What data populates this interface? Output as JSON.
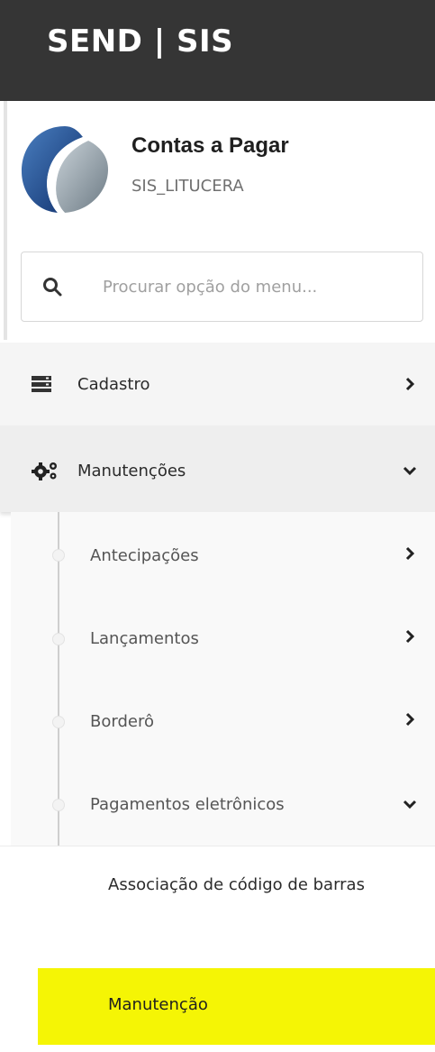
{
  "header": {
    "brand": "SEND | SIS"
  },
  "profile": {
    "title": "Contas a Pagar",
    "subtitle": "SIS_LITUCERA"
  },
  "search": {
    "placeholder": "Procurar opção do menu...",
    "value": ""
  },
  "menu": {
    "items": [
      {
        "label": "Cadastro",
        "icon": "server-stack-icon",
        "state": "collapsed"
      },
      {
        "label": "Manutenções",
        "icon": "gears-icon",
        "state": "expanded"
      }
    ],
    "submenu": [
      {
        "label": "Antecipações",
        "state": "collapsed"
      },
      {
        "label": "Lançamentos",
        "state": "collapsed"
      },
      {
        "label": "Borderô",
        "state": "collapsed"
      },
      {
        "label": "Pagamentos eletrônicos",
        "state": "expanded"
      }
    ],
    "leaves": [
      {
        "label": "Associação de código de barras",
        "active": false
      },
      {
        "label": "Manutenção",
        "active": true
      }
    ]
  },
  "colors": {
    "topbar": "#353535",
    "active_highlight": "#f5f505",
    "text": "#2b2b2b",
    "muted": "#707070"
  }
}
